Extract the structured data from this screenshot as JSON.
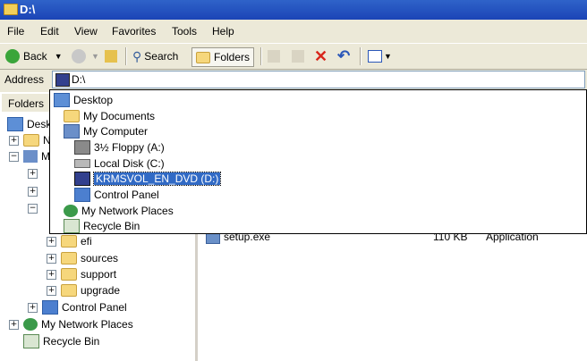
{
  "window": {
    "title": "D:\\"
  },
  "menu": [
    "File",
    "Edit",
    "View",
    "Favorites",
    "Tools",
    "Help"
  ],
  "toolbar": {
    "back": "Back",
    "search": "Search",
    "folders": "Folders"
  },
  "address": {
    "label": "Address",
    "value": "D:\\"
  },
  "dropdown": {
    "items": [
      {
        "label": "Desktop",
        "icon": "desktop-icon"
      },
      {
        "label": "My Documents",
        "icon": "folder-icon"
      },
      {
        "label": "My Computer",
        "icon": "computer-icon"
      },
      {
        "label": "3½ Floppy (A:)",
        "icon": "floppy-icon"
      },
      {
        "label": "Local Disk (C:)",
        "icon": "disk-icon"
      },
      {
        "label": "KRMSVOL_EN_DVD (D:)",
        "icon": "dvd-icon"
      },
      {
        "label": "Control Panel",
        "icon": "control-panel-icon"
      },
      {
        "label": "My Network Places",
        "icon": "network-icon"
      },
      {
        "label": "Recycle Bin",
        "icon": "recycle-bin-icon"
      }
    ],
    "selected_index": 5
  },
  "folders_pane": {
    "header": "Folders",
    "tree_partial": [
      "Desk",
      "N",
      "M"
    ],
    "tree": [
      {
        "label": "efi"
      },
      {
        "label": "sources"
      },
      {
        "label": "support"
      },
      {
        "label": "upgrade"
      },
      {
        "label": "Control Panel"
      },
      {
        "label": "My Network Places"
      },
      {
        "label": "Recycle Bin"
      }
    ]
  },
  "files": [
    {
      "name": "setup.exe",
      "size": "110 KB",
      "type": "Application"
    }
  ]
}
